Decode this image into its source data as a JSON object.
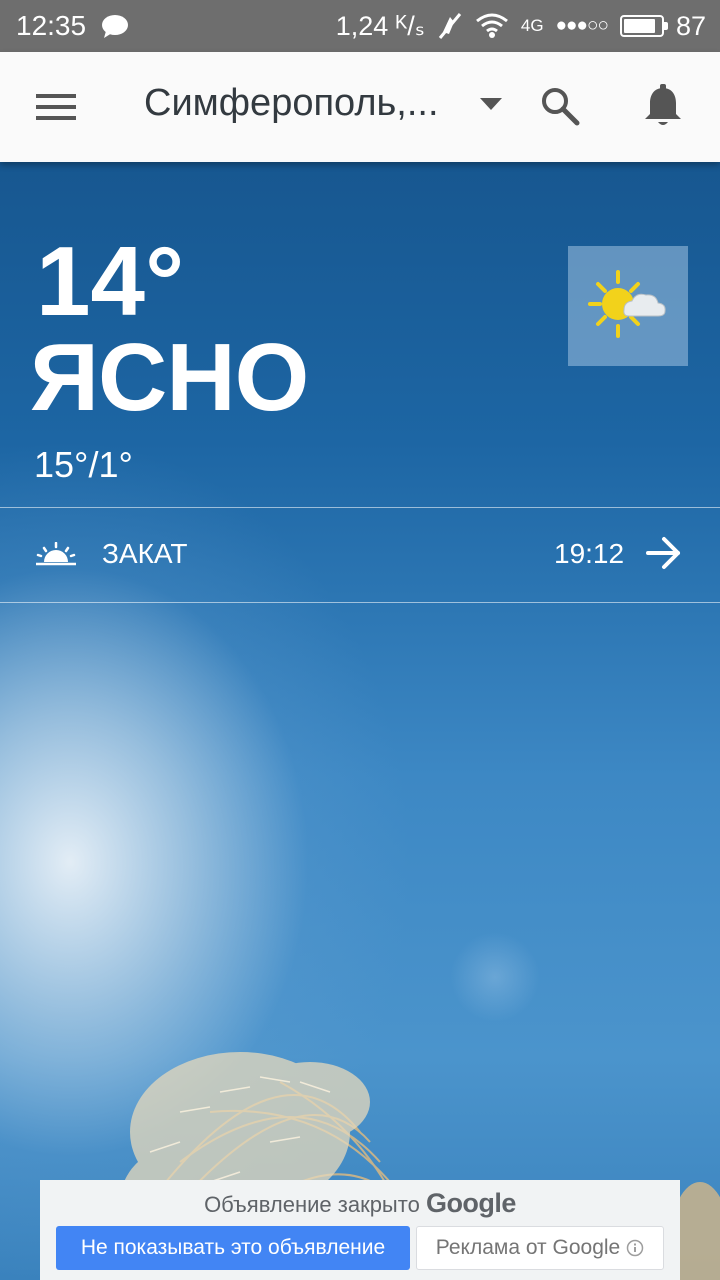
{
  "status_bar": {
    "time": "12:35",
    "speed": "1,24 ᴷ/ₛ",
    "network": "4G",
    "signal_dots": "●●●○○",
    "battery": "87",
    "battery_level": 0.87,
    "icons": [
      "chat-icon",
      "mute-icon",
      "wifi-icon",
      "battery-icon"
    ]
  },
  "app_bar": {
    "location": "Симферополь,...",
    "icons": [
      "menu-icon",
      "chevron-down-icon",
      "search-icon",
      "bell-icon"
    ]
  },
  "weather": {
    "temperature": "14°",
    "condition": "ЯСНО",
    "hi_lo": "15°/1°",
    "condition_icon": "sun-cloud-icon"
  },
  "sunset": {
    "label": "ЗАКАТ",
    "time": "19:12",
    "icons": [
      "sunset-icon",
      "arrow-right-icon"
    ]
  },
  "ad": {
    "closed_text": "Объявление закрыто",
    "google_word": "Google",
    "hide_button": "Не показывать это объявление",
    "ads_by": "Реклама от Google"
  },
  "colors": {
    "status_bar": "#6e6e6e",
    "app_bar": "#fafafa",
    "sky_top": "#175790",
    "ad_button": "#4285f4",
    "sun_icon": "#f2d21b"
  }
}
